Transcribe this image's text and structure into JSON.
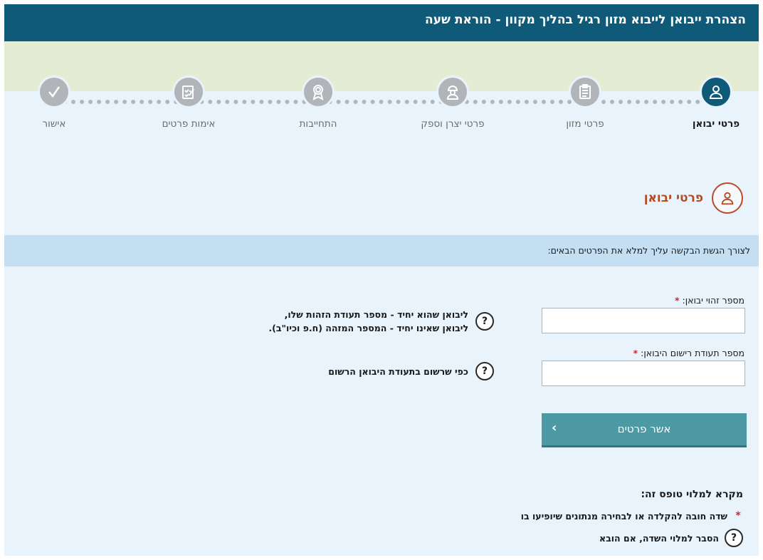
{
  "header": {
    "title": "הצהרת ייבואן לייבוא מזון רגיל בהליך מקוון - הוראת שעה"
  },
  "steps": [
    {
      "label": "פרטי יבואן",
      "icon": "user-icon",
      "active": true
    },
    {
      "label": "פרטי מזון",
      "icon": "clipboard-icon",
      "active": false
    },
    {
      "label": "פרטי יצרן וספק",
      "icon": "worker-icon",
      "active": false
    },
    {
      "label": "התחייבות",
      "icon": "badge-icon",
      "active": false
    },
    {
      "label": "אימות פרטים",
      "icon": "checklist-icon",
      "active": false
    },
    {
      "label": "אישור",
      "icon": "checkmark-icon",
      "active": false
    }
  ],
  "section": {
    "title": "פרטי יבואן",
    "icon": "user-icon"
  },
  "instructions": "לצורך הגשת הבקשה עליך למלא את הפרטים הבאים:",
  "form": {
    "importer_id": {
      "label": "מספר זהוי יבואן:",
      "value": "",
      "help_line1": "ליבואן שהוא יחיד - מספר תעודת הזהות שלו,",
      "help_line2": "ליבואן שאינו יחיד - המספר המזהה (ח.פ וכיו\"ב)."
    },
    "registration_name": {
      "label": "מספר תעודת רישום היבואן:",
      "value": "",
      "help": "כפי שרשום בתעודת היבואן הרשום"
    },
    "required_mark": "*",
    "help_mark": "?",
    "confirm_button": "אשר פרטים",
    "confirm_chevron": "‹"
  },
  "legend": {
    "title": "מקרא למלוי טופס זה:",
    "required_text": "שדה חובה להקלדה או לבחירה מנתונים שיופיעו בו",
    "help_text": "הסבר למלוי השדה, אם הובא"
  },
  "colors": {
    "header_bg": "#0f5a78",
    "active_step": "#0f5a78",
    "inactive_step": "#b1b5b9",
    "section_accent": "#b24a22",
    "button_bg": "#4e9aa4",
    "required_star": "#c8283a"
  }
}
